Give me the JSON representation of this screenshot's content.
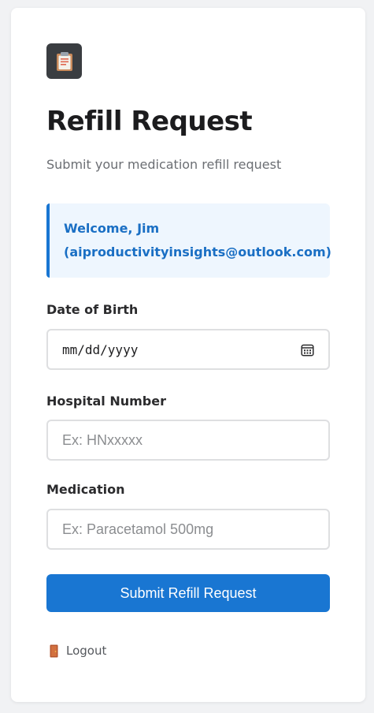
{
  "header": {
    "app_icon": "clipboard-icon",
    "title": "Refill Request",
    "subtitle": "Submit your medication refill request"
  },
  "welcome": {
    "line1": "Welcome, Jim",
    "line2": "(aiproductivityinsights@outlook.com)"
  },
  "form": {
    "dob": {
      "label": "Date of Birth",
      "value": "mm/dd/yyyy",
      "icon": "calendar-icon"
    },
    "hospital_number": {
      "label": "Hospital Number",
      "placeholder": "Ex: HNxxxxx"
    },
    "medication": {
      "label": "Medication",
      "placeholder": "Ex: Paracetamol 500mg"
    },
    "submit_label": "Submit Refill Request"
  },
  "logout": {
    "icon": "door-icon",
    "label": "Logout"
  },
  "colors": {
    "accent": "#1976d2",
    "welcome_bg": "#eef6fe",
    "icon_bg": "#3a3d41"
  }
}
